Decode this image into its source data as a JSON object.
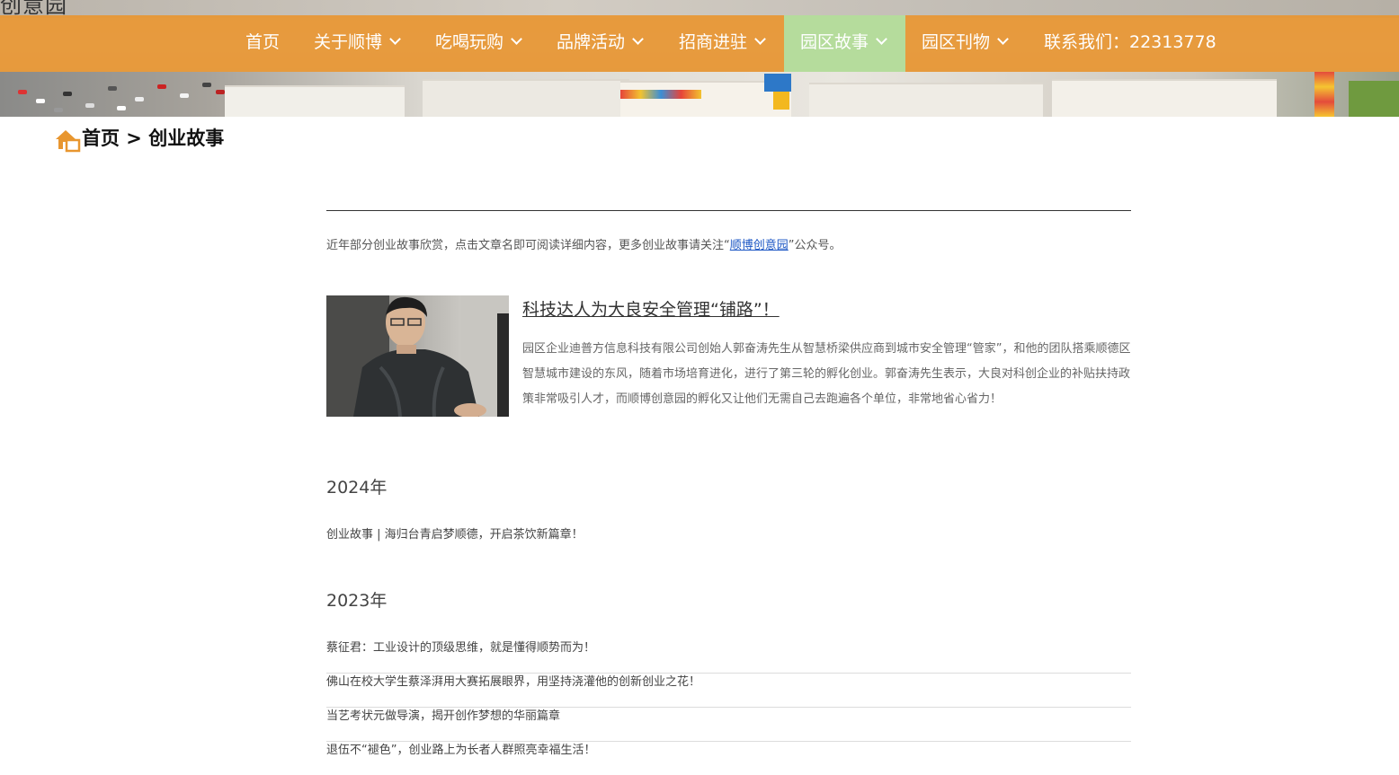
{
  "site": {
    "logo_text": "创意园"
  },
  "nav": {
    "items": [
      {
        "label": "首页",
        "dropdown": false
      },
      {
        "label": "关于顺博",
        "dropdown": true
      },
      {
        "label": "吃喝玩购",
        "dropdown": true
      },
      {
        "label": "品牌活动",
        "dropdown": true
      },
      {
        "label": "招商进驻",
        "dropdown": true
      },
      {
        "label": "园区故事",
        "dropdown": true,
        "active": true
      },
      {
        "label": "园区刊物",
        "dropdown": true
      },
      {
        "label": "联系我们：22313778",
        "dropdown": false
      }
    ],
    "colors": {
      "bar": "#e89632",
      "active": "#b5dc9c"
    }
  },
  "breadcrumb": {
    "text": "首页 > 创业故事",
    "icon": "home-icon"
  },
  "intro": {
    "before": "近年部分创业故事欣赏，点击文章名即可阅读详细内容，更多创业故事请关注“",
    "link": "顺博创意园",
    "after": "”公众号。"
  },
  "feature": {
    "title": "科技达人为大良安全管理“铺路”！",
    "description": "园区企业迪普方信息科技有限公司创始人郭奋涛先生从智慧桥梁供应商到城市安全管理“管家”，和他的团队搭乘顺德区智慧城市建设的东风，随着市场培育进化，进行了第三轮的孵化创业。郭奋涛先生表示，大良对科创企业的补贴扶持政策非常吸引人才，而顺博创意园的孵化又让他们无需自己去跑遍各个单位，非常地省心省力！"
  },
  "sections": [
    {
      "year": "2024年",
      "items": [
        "创业故事 | 海归台青启梦顺德，开启茶饮新篇章！"
      ]
    },
    {
      "year": "2023年",
      "items": [
        "蔡征君：工业设计的顶级思维，就是懂得顺势而为！",
        "佛山在校大学生蔡泽湃用大赛拓展眼界，用坚持浇灌他的创新创业之花！",
        "当艺考状元做导演，揭开创作梦想的华丽篇章",
        "退伍不“褪色”，创业路上为长者人群照亮幸福生活！"
      ]
    }
  ]
}
